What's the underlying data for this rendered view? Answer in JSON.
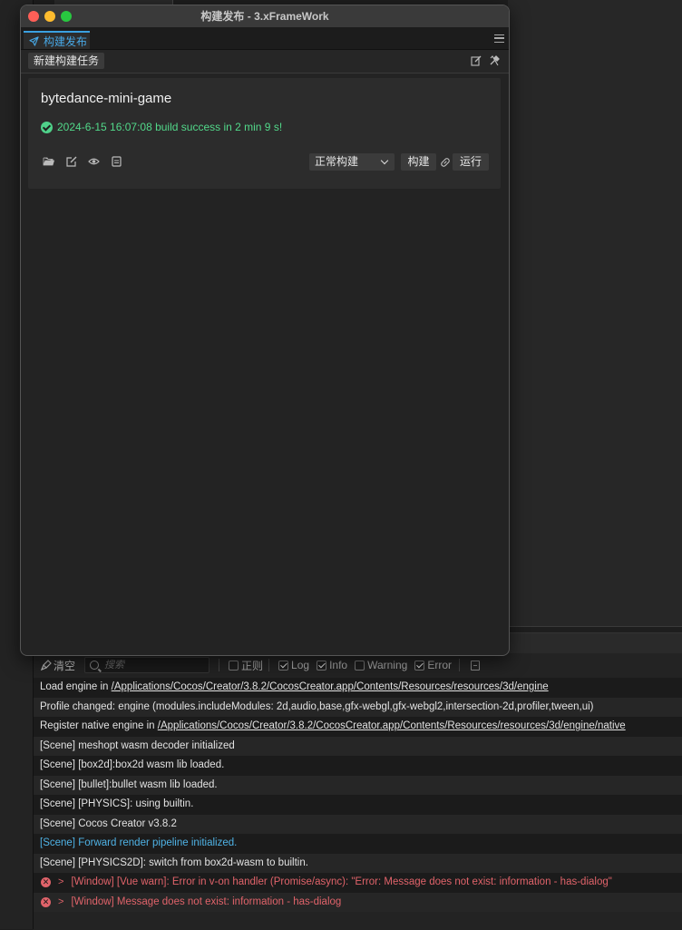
{
  "window": {
    "title": "构建发布 - 3.xFrameWork",
    "tab_label": "构建发布",
    "new_task_label": "新建构建任务"
  },
  "build_task": {
    "platform_name": "bytedance-mini-game",
    "status_text": "2024-6-15 16:07:08 build success in 2 min 9 s!",
    "build_mode": "正常构建",
    "build_label": "构建",
    "run_label": "运行",
    "icons": [
      "folder-open-icon",
      "edit-icon",
      "eye-icon",
      "doc-icon",
      "link-icon"
    ]
  },
  "console": {
    "clear_label": "清空",
    "search_placeholder": "搜索",
    "filters": [
      {
        "label": "正则",
        "checked": false
      },
      {
        "label": "Log",
        "checked": true
      },
      {
        "label": "Info",
        "checked": true
      },
      {
        "label": "Warning",
        "checked": false
      },
      {
        "label": "Error",
        "checked": true
      }
    ],
    "logs": {
      "r0_prefix": "Load engine in ",
      "r0_link": "/Applications/Cocos/Creator/3.8.2/CocosCreator.app/Contents/Resources/resources/3d/engine",
      "r1": "Profile changed: engine (modules.includeModules: 2d,audio,base,gfx-webgl,gfx-webgl2,intersection-2d,profiler,tween,ui)",
      "r2_prefix": "Register native engine in ",
      "r2_link": "/Applications/Cocos/Creator/3.8.2/CocosCreator.app/Contents/Resources/resources/3d/engine/native",
      "r3": "[Scene] meshopt wasm decoder initialized",
      "r4": "[Scene] [box2d]:box2d wasm lib loaded.",
      "r5": "[Scene] [bullet]:bullet wasm lib loaded.",
      "r6": "[Scene] [PHYSICS]: using builtin.",
      "r7": "[Scene] Cocos Creator v3.8.2",
      "r8": "[Scene] Forward render pipeline initialized.",
      "r9": "[Scene] [PHYSICS2D]: switch from box2d-wasm to builtin.",
      "r10": "[Window] [Vue warn]: Error in v-on handler (Promise/async): \"Error: Message does not exist: information - has-dialog\"",
      "r11": "[Window] Message does not exist: information - has-dialog"
    }
  },
  "colors": {
    "accent": "#3aa0e0",
    "success": "#52d98a",
    "error": "#e0636a",
    "info": "#4fb3e6"
  }
}
